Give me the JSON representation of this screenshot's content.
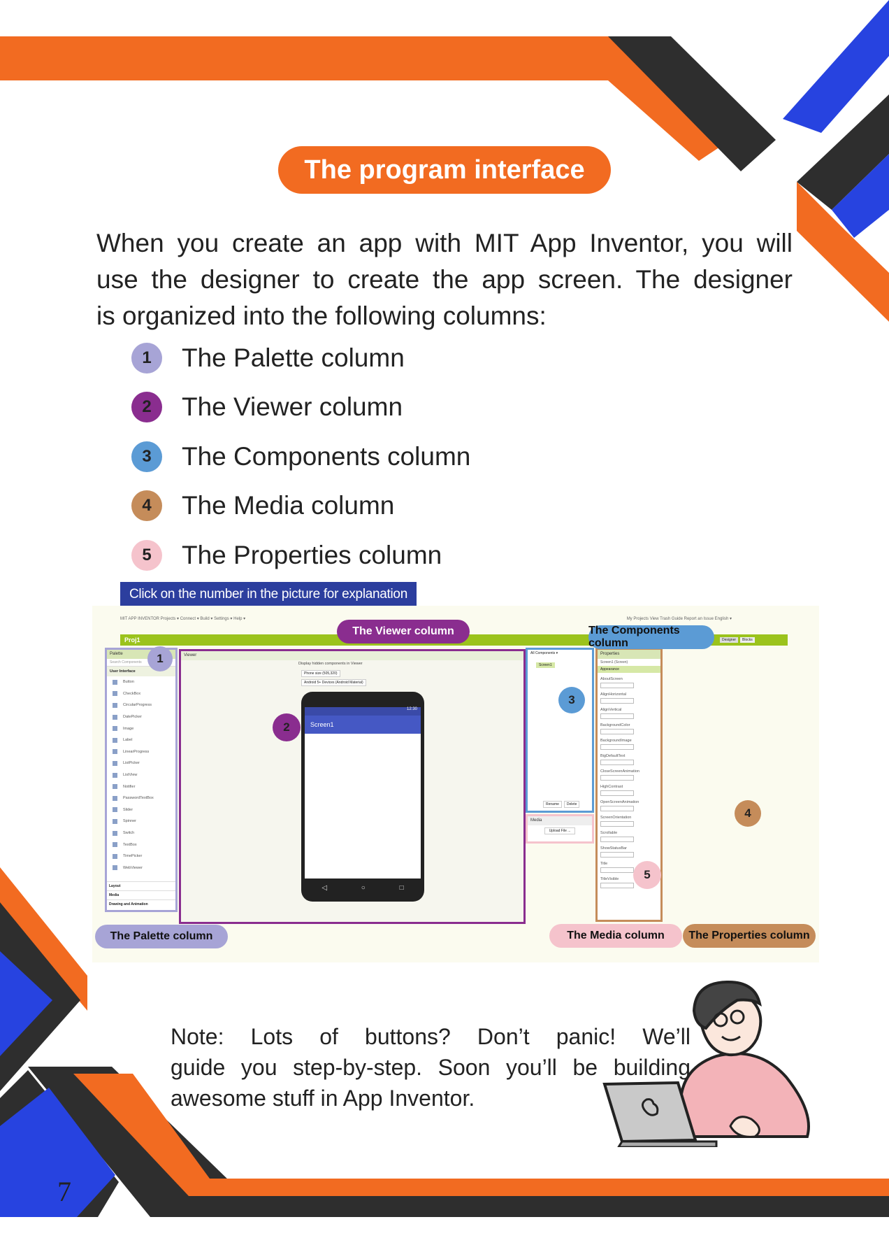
{
  "page": {
    "title": "The program interface",
    "intro_lines": [
      "When you create an app with MIT App Inventor, you will",
      "use the designer to create the app screen. The designer",
      "is organized into the following columns:"
    ],
    "columns": [
      {
        "num": "1",
        "label": "The Palette column",
        "color": "#a7a4d6"
      },
      {
        "num": "2",
        "label": "The Viewer column",
        "color": "#8a2d8f"
      },
      {
        "num": "3",
        "label": "The Components column",
        "color": "#5b9bd5"
      },
      {
        "num": "4",
        "label": "The Media column",
        "color": "#c58c5a"
      },
      {
        "num": "5",
        "label": "The Properties column",
        "color": "#f5c3cc"
      }
    ],
    "hint": "Click on the number in the picture for explanation",
    "note_lines": [
      "Note: Lots of buttons? Don’t panic! We’ll",
      "guide you step-by-step. Soon you’ll be building",
      "awesome stuff in App Inventor."
    ],
    "page_number": "7"
  },
  "screenshot": {
    "topbar_text": "MIT APP INVENTOR   Projects ▾   Connect ▾   Build ▾   Settings ▾   Help ▾",
    "topbar_right": "My Projects   View Trash   Guide   Report an Issue   English ▾",
    "project_name": "Proj1",
    "palette_head": "Palette",
    "palette_search": "Search Components",
    "palette_section": "User Interface",
    "palette_items": [
      "Button",
      "CheckBox",
      "CircularProgress",
      "DatePicker",
      "Image",
      "Label",
      "LinearProgress",
      "ListPicker",
      "ListView",
      "Notifier",
      "PasswordTextBox",
      "Slider",
      "Spinner",
      "Switch",
      "TextBox",
      "TimePicker",
      "WebViewer"
    ],
    "palette_footer": [
      "Layout",
      "Media",
      "Drawing and Animation"
    ],
    "viewer_head": "Viewer",
    "viewer_checkbox": "Display hidden components in Viewer",
    "viewer_size": "Phone size (505,320)",
    "viewer_theme": "Android 5+ Devices (Android Material)",
    "phone_time": "12:30",
    "phone_screen_title": "Screen1",
    "components_head": "All Components ▾",
    "components_item": "Screen1",
    "components_buttons": [
      "Rename",
      "Delete"
    ],
    "media_head": "Media",
    "media_button": "Upload File ...",
    "properties_head": "Properties",
    "properties_sub": "Screen1 (Screen)",
    "properties_group": "Appearance",
    "properties": [
      "AboutScreen",
      "AlignHorizontal",
      "AlignVertical",
      "BackgroundColor",
      "BackgroundImage",
      "BigDefaultText",
      "CloseScreenAnimation",
      "HighContrast",
      "OpenScreenAnimation",
      "ScreenOrientation",
      "Scrollable",
      "ShowStatusBar",
      "Title",
      "TitleVisible"
    ],
    "designer_buttons": [
      "Designer",
      "Blocks"
    ],
    "tags": {
      "viewer": "The Viewer column",
      "components": "The Components column",
      "palette": "The Palette column",
      "media": "The Media column",
      "properties": "The Properties column"
    },
    "badges": [
      "1",
      "2",
      "3",
      "4",
      "5"
    ]
  }
}
